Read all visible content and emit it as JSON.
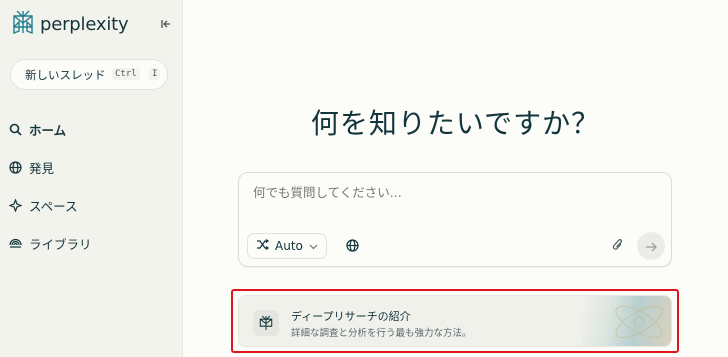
{
  "sidebar": {
    "brand": "perplexity",
    "new_thread": {
      "label": "新しいスレッド",
      "kbd_ctrl": "Ctrl",
      "kbd_key": "I"
    },
    "items": [
      {
        "label": "ホーム",
        "icon": "home-search-icon",
        "active": true
      },
      {
        "label": "発見",
        "icon": "globe-icon",
        "active": false
      },
      {
        "label": "スペース",
        "icon": "spaces-icon",
        "active": false
      },
      {
        "label": "ライブラリ",
        "icon": "library-icon",
        "active": false
      }
    ]
  },
  "main": {
    "hero": "何を知りたいですか？",
    "composer": {
      "placeholder": "何でも質問してください...",
      "mode": "Auto"
    },
    "promo": {
      "title": "ディープリサーチの紹介",
      "subtitle": "詳細な調査と分析を行う最も強力な方法。"
    }
  },
  "colors": {
    "accent": "#20808d",
    "text": "#13343b",
    "highlight_outline": "#e0141e"
  }
}
